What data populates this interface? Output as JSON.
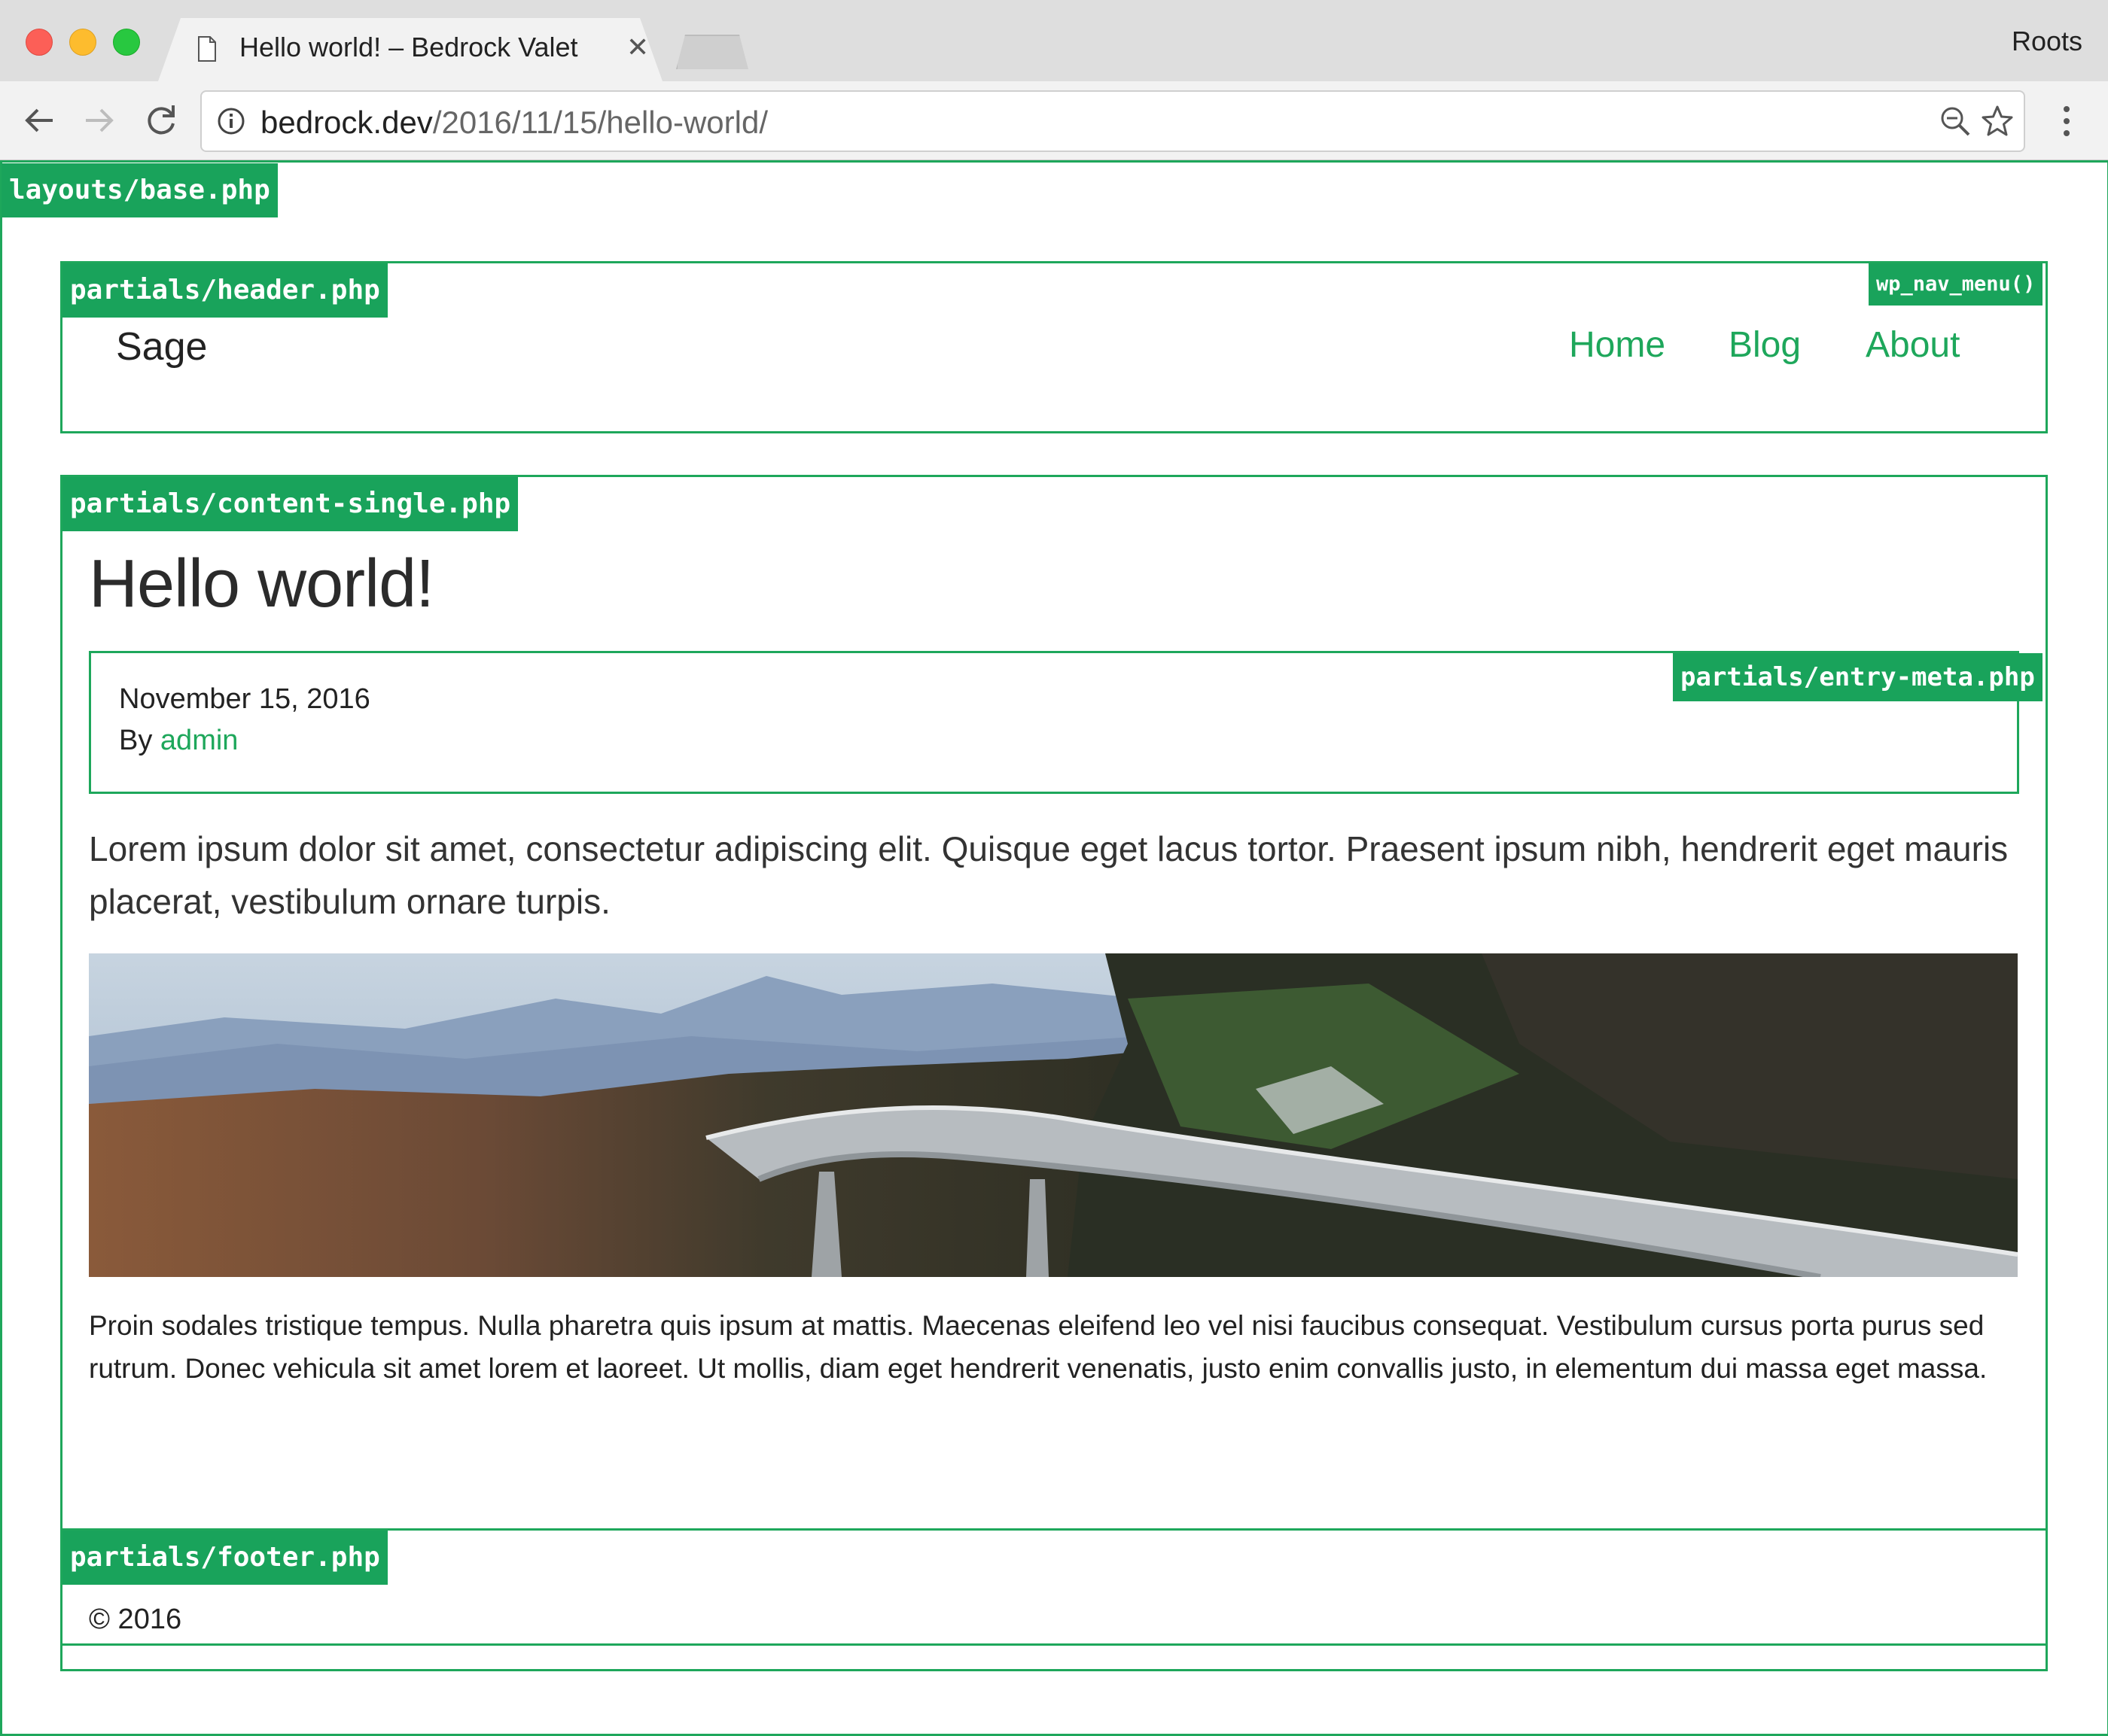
{
  "browser": {
    "tab_title": "Hello world! – Bedrock Valet",
    "profile_name": "Roots",
    "url_host": "bedrock.dev",
    "url_path": "/2016/11/15/hello-world/"
  },
  "debug_tags": {
    "base": "layouts/base.php",
    "header": "partials/header.php",
    "nav_menu": "wp_nav_menu()",
    "content": "partials/content-single.php",
    "entry_meta": "partials/entry-meta.php",
    "footer": "partials/footer.php"
  },
  "header": {
    "brand": "Sage",
    "nav": [
      {
        "label": "Home"
      },
      {
        "label": "Blog"
      },
      {
        "label": "About"
      }
    ]
  },
  "post": {
    "title": "Hello world!",
    "date": "November 15, 2016",
    "by_prefix": "By",
    "author": "admin",
    "lead": "Lorem ipsum dolor sit amet, consectetur adipiscing elit. Quisque eget lacus tortor. Praesent ipsum nibh, hendrerit eget mauris placerat, vestibulum ornare turpis.",
    "body": "Proin sodales tristique tempus. Nulla pharetra quis ipsum at mattis. Maecenas eleifend leo vel nisi faucibus consequat. Vestibulum cursus porta purus sed rutrum. Donec vehicula sit amet lorem et laoreet. Ut mollis, diam eget hendrerit venenatis, justo enim convallis justo, in elementum dui massa eget massa."
  },
  "footer": {
    "copyright": "© 2016"
  },
  "colors": {
    "accent": "#1ea75b",
    "tag_bg": "#19a35b"
  }
}
